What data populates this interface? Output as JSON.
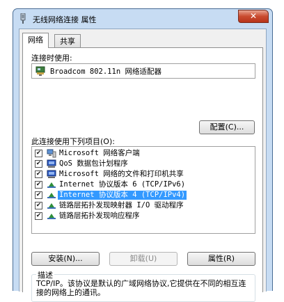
{
  "window": {
    "title": "无线网络连接 属性",
    "close_label": "✕"
  },
  "tabs": [
    {
      "label": "网络"
    },
    {
      "label": "共享"
    }
  ],
  "connection": {
    "label": "连接时使用:",
    "adapter": "Broadcom 802.11n 网络适配器",
    "configure_label": "配置(C)..."
  },
  "items_label": "此连接使用下列项目(O):",
  "items": [
    {
      "label": "Microsoft 网络客户端",
      "checked": "✔",
      "icon": "network-client-icon"
    },
    {
      "label": "QoS 数据包计划程序",
      "checked": "✔",
      "icon": "qos-scheduler-icon"
    },
    {
      "label": "Microsoft 网络的文件和打印机共享",
      "checked": "✔",
      "icon": "file-print-sharing-icon"
    },
    {
      "label": "Internet 协议版本 6 (TCP/IPv6)",
      "checked": "✔",
      "icon": "protocol-icon"
    },
    {
      "label": "Internet 协议版本 4 (TCP/IPv4)",
      "checked": "✔",
      "icon": "protocol-icon"
    },
    {
      "label": "链路层拓扑发现映射器 I/O 驱动程序",
      "checked": "✔",
      "icon": "protocol-icon"
    },
    {
      "label": "链路层拓扑发现响应程序",
      "checked": "✔",
      "icon": "protocol-icon"
    }
  ],
  "buttons": {
    "install": "安装(N)...",
    "uninstall": "卸载(U)",
    "properties": "属性(R)"
  },
  "description": {
    "legend": "描述",
    "text": "TCP/IP。该协议是默认的广域网络协议,它提供在不同的相互连接的网络上的通讯。"
  }
}
